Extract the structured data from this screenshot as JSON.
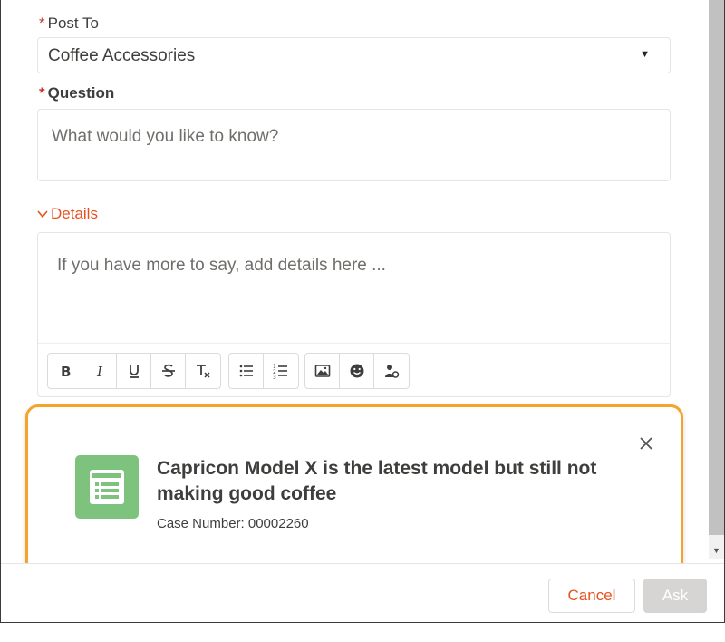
{
  "post_to": {
    "required_marker": "*",
    "label": "Post To",
    "value": "Coffee Accessories"
  },
  "question": {
    "required_marker": "*",
    "label": "Question",
    "placeholder": "What would you like to know?"
  },
  "details": {
    "toggle_label": "Details",
    "placeholder": "If you have more to say, add details here ...",
    "toolbar": [
      "bold-icon",
      "italic-icon",
      "underline-icon",
      "strikethrough-icon",
      "clear-format-icon",
      "bullet-list-icon",
      "numbered-list-icon",
      "image-icon",
      "emoji-icon",
      "mention-icon"
    ]
  },
  "suggestion_card": {
    "title": "Capricon Model X is the latest model but still not making good coffee",
    "case_number": "Case Number: 00002260",
    "icon": "case-document-icon",
    "highlight_color": "#f4a32b",
    "icon_color": "#7dc37d"
  },
  "footer": {
    "cancel_label": "Cancel",
    "ask_label": "Ask"
  },
  "colors": {
    "accent": "#e8511e",
    "required": "#c23934"
  }
}
